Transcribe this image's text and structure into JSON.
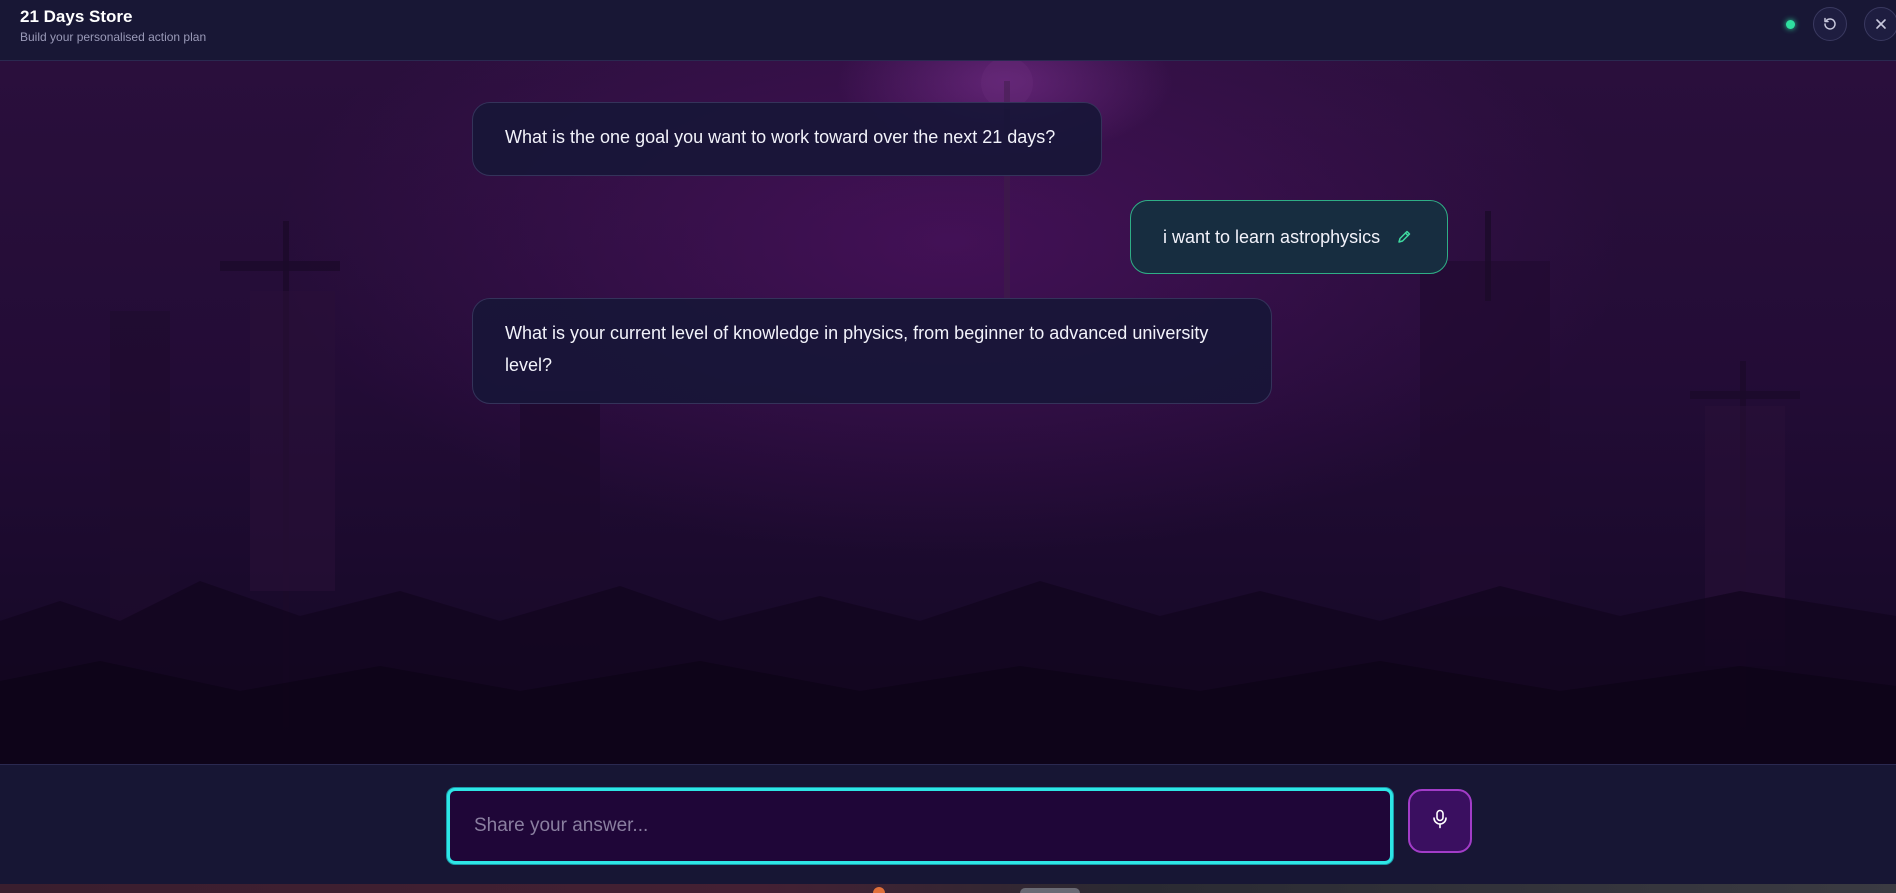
{
  "header": {
    "title": "21 Days Store",
    "subtitle": "Build your personalised action plan",
    "status_color": "#2fe0a0",
    "reset_icon": "reset-icon",
    "close_icon": "close-icon"
  },
  "chat": {
    "messages": [
      {
        "role": "assistant",
        "text": "What is the one goal you want to work toward over the next 21 days?"
      },
      {
        "role": "user",
        "text": "i want to learn astrophysics",
        "icon": "pencil-icon"
      },
      {
        "role": "assistant",
        "text": "What is your current level of knowledge in physics, from beginner to advanced university level?"
      }
    ]
  },
  "composer": {
    "placeholder": "Share your answer...",
    "value": "",
    "mic_icon": "microphone-icon",
    "accent_color": "#2ee6e6",
    "mic_color": "#a23cc8"
  }
}
